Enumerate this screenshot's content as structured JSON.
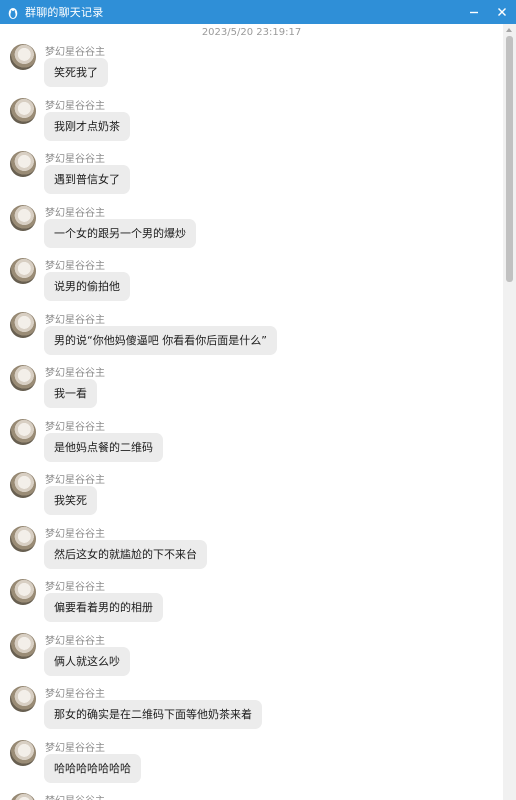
{
  "window": {
    "title": "群聊的聊天记录",
    "icon": "penguin-icon",
    "controls": {
      "minimize_icon": "minimize-icon",
      "close_icon": "close-icon"
    }
  },
  "chat": {
    "timestamp": "2023/5/20 23:19:17",
    "messages": [
      {
        "sender": "梦幻星谷谷主",
        "text": "笑死我了"
      },
      {
        "sender": "梦幻星谷谷主",
        "text": "我刚才点奶茶"
      },
      {
        "sender": "梦幻星谷谷主",
        "text": "遇到普信女了"
      },
      {
        "sender": "梦幻星谷谷主",
        "text": "一个女的跟另一个男的爆炒"
      },
      {
        "sender": "梦幻星谷谷主",
        "text": "说男的偷拍他"
      },
      {
        "sender": "梦幻星谷谷主",
        "text": "男的说“你他妈傻逼吧 你看看你后面是什么”"
      },
      {
        "sender": "梦幻星谷谷主",
        "text": "我一看"
      },
      {
        "sender": "梦幻星谷谷主",
        "text": "是他妈点餐的二维码"
      },
      {
        "sender": "梦幻星谷谷主",
        "text": "我笑死"
      },
      {
        "sender": "梦幻星谷谷主",
        "text": "然后这女的就尴尬的下不来台"
      },
      {
        "sender": "梦幻星谷谷主",
        "text": "偏要看着男的的相册"
      },
      {
        "sender": "梦幻星谷谷主",
        "text": "俩人就这么吵"
      },
      {
        "sender": "梦幻星谷谷主",
        "text": "那女的确实是在二维码下面等他奶茶来着"
      },
      {
        "sender": "梦幻星谷谷主",
        "text": "哈哈哈哈哈哈哈"
      },
      {
        "sender": "梦幻星谷谷主",
        "text": ""
      }
    ]
  },
  "colors": {
    "titlebar": "#2f8fd7",
    "bubble": "#ececec",
    "sender_text": "#8c8c8c",
    "timestamp_text": "#9a9a9a"
  }
}
